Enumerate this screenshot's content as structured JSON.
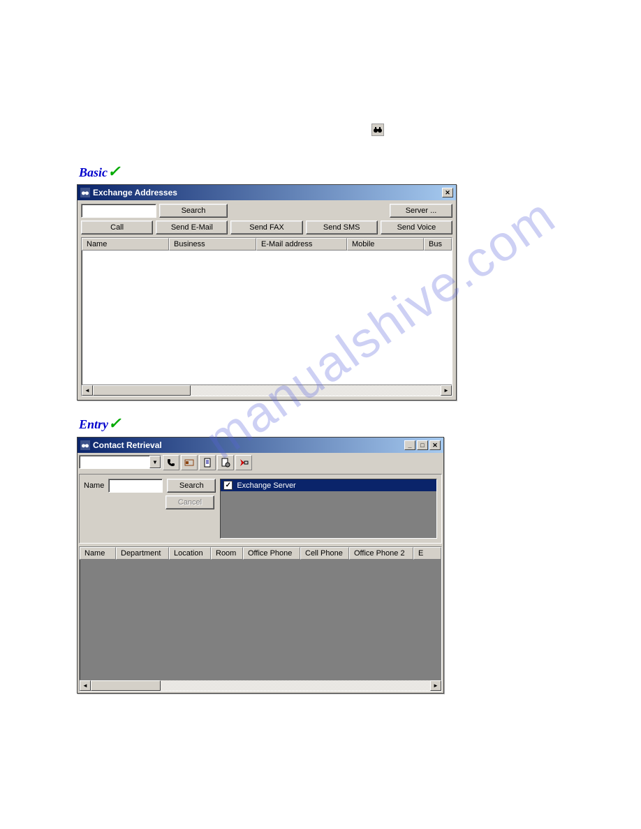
{
  "standalone_icon": "binoculars-icon",
  "badges": {
    "basic": "Basic",
    "entry": "Entry"
  },
  "window1": {
    "title": "Exchange Addresses",
    "search_button": "Search",
    "server_button": "Server ...",
    "action_buttons": {
      "call": "Call",
      "email": "Send E-Mail",
      "fax": "Send FAX",
      "sms": "Send SMS",
      "voice": "Send Voice"
    },
    "columns": [
      "Name",
      "Business",
      "E-Mail address",
      "Mobile",
      "Bus"
    ]
  },
  "window2": {
    "title": "Contact Retrieval",
    "name_label": "Name",
    "search_button": "Search",
    "cancel_button": "Cancel",
    "source_item": "Exchange Server",
    "columns": [
      "Name",
      "Department",
      "Location",
      "Room",
      "Office Phone",
      "Cell Phone",
      "Office Phone 2",
      "E"
    ]
  }
}
